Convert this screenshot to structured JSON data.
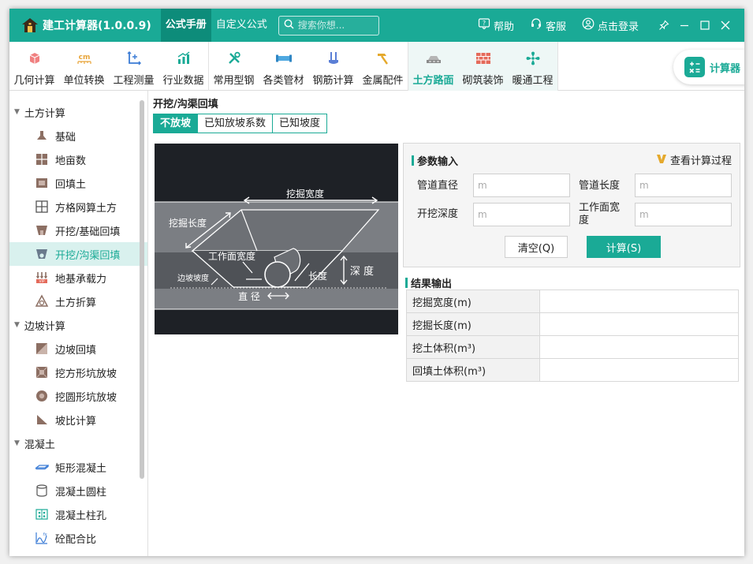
{
  "app": {
    "title": "建工计算器(1.0.0.9)"
  },
  "top_tabs": [
    {
      "label": "公式手册",
      "active": true
    },
    {
      "label": "自定义公式",
      "active": false
    }
  ],
  "search": {
    "placeholder": "搜索你想..."
  },
  "title_bar_links": {
    "help": "帮助",
    "service": "客服",
    "login": "点击登录"
  },
  "ribbon": {
    "groups": [
      {
        "items": [
          {
            "label": "几何计算",
            "icon": "cube-icon"
          },
          {
            "label": "单位转换",
            "icon": "unit-cm-icon"
          },
          {
            "label": "工程测量",
            "icon": "axis-measure-icon"
          },
          {
            "label": "行业数据",
            "icon": "bar-chart-icon"
          }
        ]
      },
      {
        "items": [
          {
            "label": "常用型钢",
            "icon": "wrench-tools-icon"
          },
          {
            "label": "各类管材",
            "icon": "pipe-icon"
          },
          {
            "label": "钢筋计算",
            "icon": "rebar-icon"
          },
          {
            "label": "金属配件",
            "icon": "hammer-icon"
          }
        ]
      },
      {
        "items": [
          {
            "label": "土方路面",
            "icon": "road-icon",
            "active": true
          },
          {
            "label": "砌筑装饰",
            "icon": "brick-icon"
          },
          {
            "label": "暖通工程",
            "icon": "fan-icon"
          }
        ]
      }
    ],
    "calculator_label": "计算器"
  },
  "sidebar": {
    "groups": [
      {
        "label": "土方计算",
        "items": [
          {
            "label": "基础",
            "icon": "foundation-icon"
          },
          {
            "label": "地亩数",
            "icon": "land-plot-icon"
          },
          {
            "label": "回填土",
            "icon": "backfill-icon"
          },
          {
            "label": "方格网算土方",
            "icon": "grid-icon"
          },
          {
            "label": "开挖/基础回填",
            "icon": "excavation-icon"
          },
          {
            "label": "开挖/沟渠回填",
            "icon": "trench-icon",
            "active": true
          },
          {
            "label": "地基承载力",
            "icon": "bearing-capacity-icon"
          },
          {
            "label": "土方折算",
            "icon": "earthwork-conversion-icon"
          }
        ]
      },
      {
        "label": "边坡计算",
        "items": [
          {
            "label": "边坡回填",
            "icon": "slope-backfill-icon"
          },
          {
            "label": "挖方形坑放坡",
            "icon": "square-pit-icon"
          },
          {
            "label": "挖圆形坑放坡",
            "icon": "round-pit-icon"
          },
          {
            "label": "坡比计算",
            "icon": "slope-ratio-icon"
          }
        ]
      },
      {
        "label": "混凝土",
        "items": [
          {
            "label": "矩形混凝土",
            "icon": "rect-concrete-icon"
          },
          {
            "label": "混凝土圆柱",
            "icon": "cylinder-icon"
          },
          {
            "label": "混凝土柱孔",
            "icon": "column-hole-icon"
          },
          {
            "label": "砼配合比",
            "icon": "mix-ratio-icon"
          }
        ]
      }
    ]
  },
  "content": {
    "title": "开挖/沟渠回填",
    "segments": [
      {
        "label": "不放坡",
        "active": true
      },
      {
        "label": "已知放坡系数",
        "active": false
      },
      {
        "label": "已知坡度",
        "active": false
      }
    ],
    "diagram_labels": {
      "dig_width": "挖掘宽度",
      "dig_length": "挖掘长度",
      "work_width": "工作面宽度",
      "slope": "边坡坡度",
      "length": "长度",
      "depth": "深 度",
      "diameter": "直 径"
    },
    "params": {
      "title": "参数输入",
      "view_process": "查看计算过程",
      "fields": [
        {
          "label": "管道直径",
          "placeholder": "m",
          "value": ""
        },
        {
          "label": "管道长度",
          "placeholder": "m",
          "value": ""
        },
        {
          "label": "开挖深度",
          "placeholder": "m",
          "value": ""
        },
        {
          "label": "工作面宽度",
          "placeholder": "m",
          "value": ""
        }
      ],
      "clear_label": "清空(Q)",
      "calc_label": "计算(S)"
    },
    "results": {
      "title": "结果输出",
      "rows": [
        {
          "label": "挖掘宽度(m)",
          "value": ""
        },
        {
          "label": "挖掘长度(m)",
          "value": ""
        },
        {
          "label": "挖土体积(m³)",
          "value": ""
        },
        {
          "label": "回填土体积(m³)",
          "value": ""
        }
      ]
    }
  },
  "colors": {
    "accent": "#1aaa96",
    "accent_dark": "#0d8c7a",
    "selected_bg": "#d9f1ee"
  }
}
